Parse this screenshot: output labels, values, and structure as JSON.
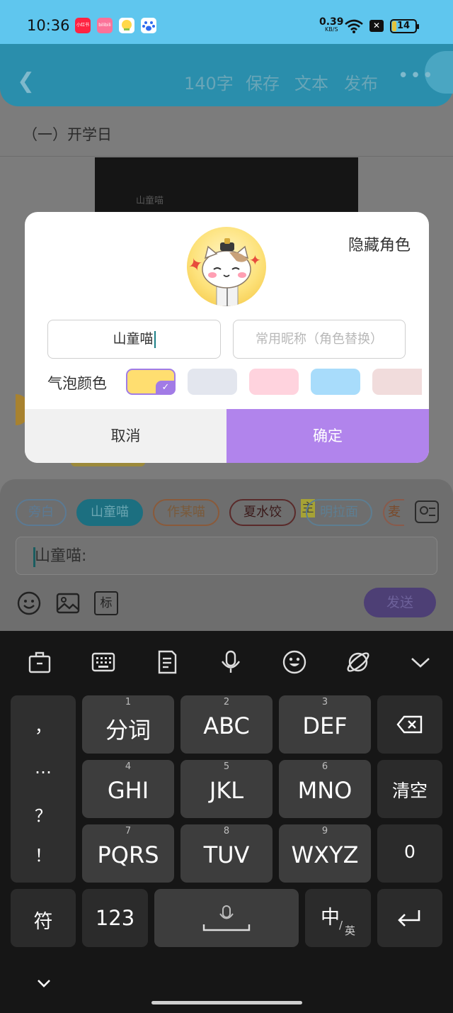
{
  "status_bar": {
    "time": "10:36",
    "apps": [
      {
        "name": "xiaohongshu-app-icon",
        "label": "小红书",
        "color": "#ff2442"
      },
      {
        "name": "bilibili-app-icon",
        "label": "bilibili",
        "color": "#fb7299"
      },
      {
        "name": "chat-app-icon",
        "label": "",
        "color": "#ffd84a"
      },
      {
        "name": "baidu-app-icon",
        "label": "",
        "color": "#2d6bf0"
      }
    ],
    "net_speed": "0.39",
    "net_unit": "KB/S",
    "battery": "14"
  },
  "header": {
    "word_count": "140字",
    "save": "保存",
    "text": "文本",
    "publish": "发布"
  },
  "page_title": "（一）开学日",
  "bg_image_caption": "山童喵",
  "dialog": {
    "hide_role": "隐藏角色",
    "name_value": "山童喵",
    "nickname_placeholder": "常用昵称（角色替换）",
    "bubble_color_label": "气泡颜色",
    "swatches": [
      "#ffde70",
      "#e3e6ee",
      "#ffd3de",
      "#a8dcfb",
      "#f1dcdc"
    ],
    "cancel": "取消",
    "confirm": "确定"
  },
  "roles": {
    "chips": [
      "旁白",
      "山童喵",
      "作某喵",
      "夏水饺",
      "明拉面"
    ],
    "marker": "主"
  },
  "message_box": {
    "value": "山童喵:"
  },
  "send": "发送",
  "tools": {
    "tag": "标"
  },
  "keyboard": {
    "punctuation": [
      "，",
      "…",
      "？",
      "！"
    ],
    "keys": [
      {
        "num": "1",
        "label": "分词"
      },
      {
        "num": "2",
        "label": "ABC"
      },
      {
        "num": "3",
        "label": "DEF"
      },
      {
        "num": "4",
        "label": "GHI"
      },
      {
        "num": "5",
        "label": "JKL"
      },
      {
        "num": "6",
        "label": "MNO"
      },
      {
        "num": "7",
        "label": "PQRS"
      },
      {
        "num": "8",
        "label": "TUV"
      },
      {
        "num": "9",
        "label": "WXYZ"
      }
    ],
    "clear": "清空",
    "zero": "0",
    "symbols": "符",
    "numbers": "123",
    "lang_main": "中",
    "lang_sub": "英"
  }
}
